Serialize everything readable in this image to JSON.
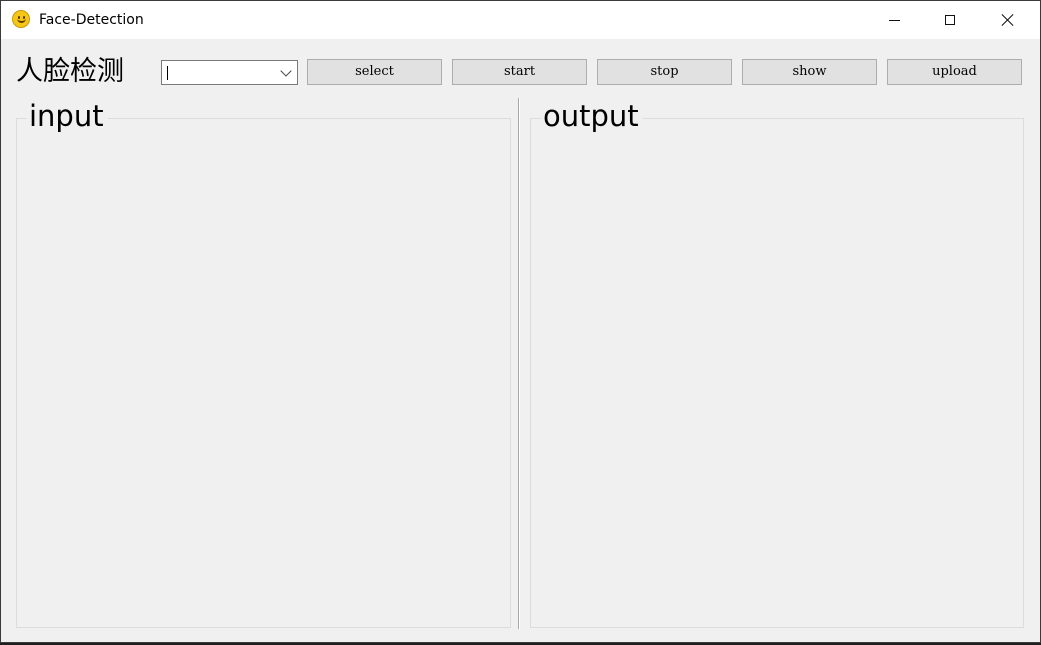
{
  "window": {
    "title": "Face-Detection"
  },
  "toolbar": {
    "heading": "人脸检测",
    "combo_value": "",
    "buttons": {
      "select": "select",
      "start": "start",
      "stop": "stop",
      "show": "show",
      "upload": "upload"
    }
  },
  "panels": {
    "input_title": "input",
    "output_title": "output"
  },
  "icons": {
    "app": "smiley-face-icon",
    "minimize": "minimize-icon",
    "maximize": "maximize-icon",
    "close": "close-icon",
    "dropdown": "chevron-down-icon"
  },
  "colors": {
    "window_bg": "#f0f0f0",
    "titlebar_bg": "#ffffff",
    "button_bg": "#e1e1e1",
    "app_icon": "#f5c518"
  }
}
